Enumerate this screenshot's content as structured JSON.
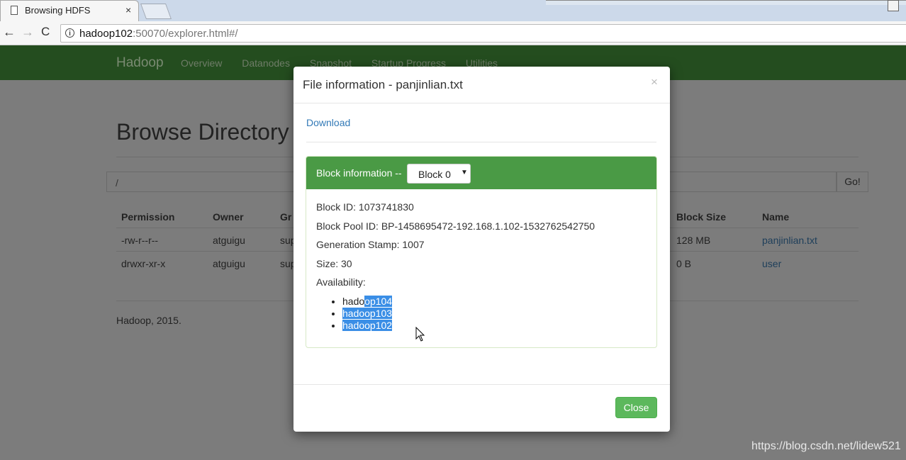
{
  "browser": {
    "tab_title": "Browsing HDFS",
    "tab_close": "×",
    "url_host": "hadoop102",
    "url_rest": ":50070/explorer.html#/",
    "info_icon": "i",
    "back": "←",
    "forward": "→",
    "reload": "C"
  },
  "navbar": {
    "brand": "Hadoop",
    "links": [
      "Overview",
      "Datanodes",
      "Snapshot",
      "Startup Progress",
      "Utilities"
    ]
  },
  "page": {
    "title": "Browse Directory",
    "path_value": "/",
    "go_label": "Go!",
    "columns": {
      "permission": "Permission",
      "owner": "Owner",
      "group": "Gr",
      "block_size": "Block Size",
      "name": "Name"
    },
    "rows": [
      {
        "permission": "-rw-r--r--",
        "owner": "atguigu",
        "group": "sup",
        "block_size": "128 MB",
        "name": "panjinlian.txt"
      },
      {
        "permission": "drwxr-xr-x",
        "owner": "atguigu",
        "group": "sup",
        "block_size": "0 B",
        "name": "user"
      }
    ],
    "footer": "Hadoop, 2015."
  },
  "modal": {
    "title": "File information - panjinlian.txt",
    "close_x": "×",
    "download": "Download",
    "block_info_label": "Block information --",
    "block_selected": "Block 0",
    "block_id": "Block ID: 1073741830",
    "block_pool_id": "Block Pool ID: BP-1458695472-192.168.1.102-1532762542750",
    "generation_stamp": "Generation Stamp: 1007",
    "size": "Size: 30",
    "availability_label": "Availability:",
    "availability": {
      "host1_plain": "hado",
      "host1_selected": "op104",
      "host2": "hadoop103",
      "host3": "hadoop102"
    },
    "close_button": "Close"
  },
  "watermark": "https://blog.csdn.net/lidew521",
  "colors": {
    "navbar": "#244d1f",
    "panel_header": "#4a9a45",
    "close_button": "#5cb85c",
    "link": "#337ab7",
    "selection": "#3a8ee6"
  }
}
